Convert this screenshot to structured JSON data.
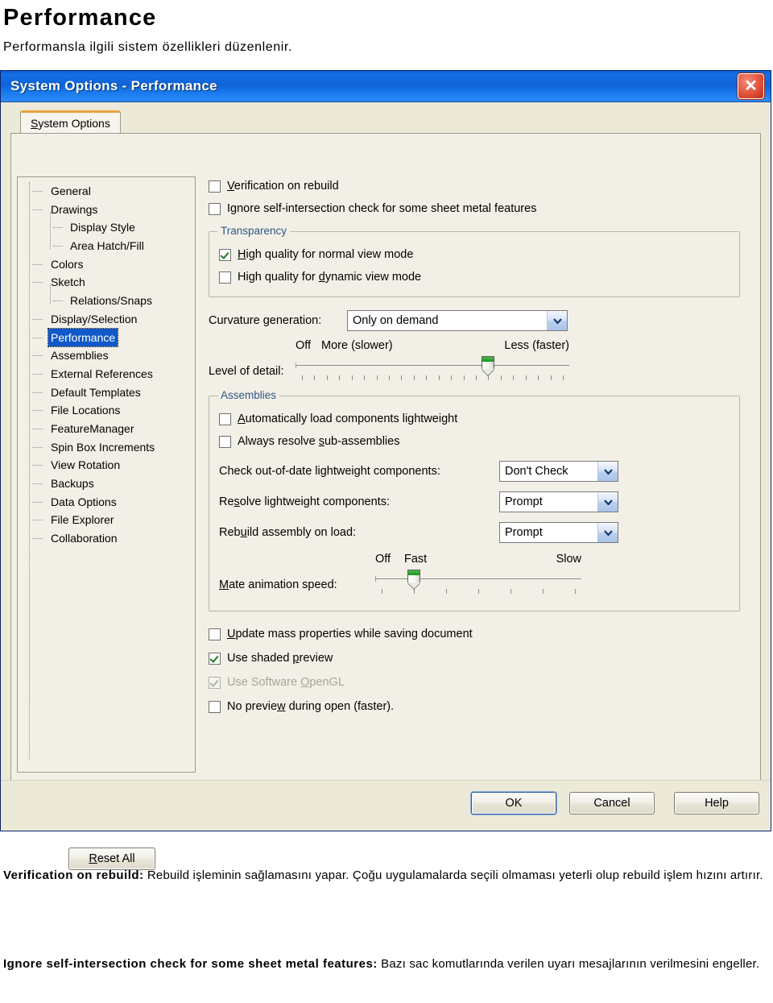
{
  "page": {
    "title": "Performance",
    "subtitle": "Performansla ilgili sistem özellikleri düzenlenir."
  },
  "dialog": {
    "title": "System Options - Performance",
    "close_icon": "✕",
    "tab": {
      "label_pre": "S",
      "label_rest": "ystem Options",
      "full": "System Options"
    }
  },
  "tree": {
    "items": [
      {
        "label": "General",
        "level": 1,
        "selected": false
      },
      {
        "label": "Drawings",
        "level": 1,
        "selected": false
      },
      {
        "label": "Display Style",
        "level": 2,
        "selected": false
      },
      {
        "label": "Area Hatch/Fill",
        "level": 2,
        "selected": false
      },
      {
        "label": "Colors",
        "level": 1,
        "selected": false
      },
      {
        "label": "Sketch",
        "level": 1,
        "selected": false
      },
      {
        "label": "Relations/Snaps",
        "level": 2,
        "selected": false
      },
      {
        "label": "Display/Selection",
        "level": 1,
        "selected": false
      },
      {
        "label": "Performance",
        "level": 1,
        "selected": true
      },
      {
        "label": "Assemblies",
        "level": 1,
        "selected": false
      },
      {
        "label": "External References",
        "level": 1,
        "selected": false
      },
      {
        "label": "Default Templates",
        "level": 1,
        "selected": false
      },
      {
        "label": "File Locations",
        "level": 1,
        "selected": false
      },
      {
        "label": "FeatureManager",
        "level": 1,
        "selected": false
      },
      {
        "label": "Spin Box Increments",
        "level": 1,
        "selected": false
      },
      {
        "label": "View Rotation",
        "level": 1,
        "selected": false
      },
      {
        "label": "Backups",
        "level": 1,
        "selected": false
      },
      {
        "label": "Data Options",
        "level": 1,
        "selected": false
      },
      {
        "label": "File Explorer",
        "level": 1,
        "selected": false
      },
      {
        "label": "Collaboration",
        "level": 1,
        "selected": false
      }
    ]
  },
  "options": {
    "verification_on_rebuild": {
      "label": "Verification on rebuild",
      "mnemonic": "V",
      "rest": "erification on rebuild",
      "checked": false
    },
    "ignore_self_intersection": {
      "label": "Ignore self-intersection check for some sheet metal features",
      "pre": "I",
      "mnemonic": "g",
      "rest": "nore self-intersection check for some sheet metal features",
      "checked": false
    },
    "transparency": {
      "title": "Transparency",
      "high_quality_normal": {
        "label": "High quality for normal view mode",
        "mnemonic": "H",
        "rest": "igh quality for normal view mode",
        "checked": true
      },
      "high_quality_dynamic": {
        "label": "High quality for dynamic view mode",
        "pre": "High quality for ",
        "mnemonic": "d",
        "rest": "ynamic view mode",
        "checked": false
      }
    },
    "curvature_generation": {
      "label": "Curvature generation:",
      "value": "Only on demand"
    },
    "level_of_detail": {
      "label": "Level of detail:",
      "cap_off": "Off",
      "cap_more": "More (slower)",
      "cap_less": "Less (faster)",
      "ticks": 22,
      "value_index": 15
    },
    "assemblies": {
      "title": "Assemblies",
      "auto_load_lightweight": {
        "label": "Automatically load components lightweight",
        "mnemonic": "A",
        "rest": "utomatically load components lightweight",
        "checked": false
      },
      "always_resolve_sub": {
        "label": "Always resolve sub-assemblies",
        "pre": "Always resolve ",
        "mnemonic": "s",
        "rest": "ub-assemblies",
        "checked": false
      },
      "check_out_of_date": {
        "label": "Check out-of-date lightweight components:",
        "value": "Don't Check"
      },
      "resolve_lightweight": {
        "label": "Resolve lightweight components:",
        "pre": "Re",
        "mnemonic": "s",
        "rest": "olve lightweight components:",
        "value": "Prompt"
      },
      "rebuild_on_load": {
        "label": "Rebuild assembly on load:",
        "pre": "Reb",
        "mnemonic": "u",
        "rest": "ild assembly on load:",
        "value": "Prompt"
      },
      "mate_animation": {
        "label": "Mate animation speed:",
        "mnemonic": "M",
        "rest": "ate animation speed:",
        "cap_off": "Off",
        "cap_fast": "Fast",
        "cap_slow": "Slow",
        "ticks": 7,
        "value_index": 1
      }
    },
    "update_mass_properties": {
      "label": "Update mass properties while saving document",
      "mnemonic": "U",
      "rest": "pdate mass properties while saving document",
      "checked": false
    },
    "use_shaded_preview": {
      "label": "Use shaded preview",
      "pre": "Use shaded ",
      "mnemonic": "p",
      "rest": "review",
      "checked": true
    },
    "use_software_opengl": {
      "label": "Use Software OpenGL",
      "pre": "Use Software ",
      "mnemonic": "O",
      "rest": "penGL",
      "checked": true,
      "disabled": true
    },
    "no_preview_during_open": {
      "label": "No preview during open (faster).",
      "pre": "No previe",
      "mnemonic": "w",
      "rest": " during open (faster).",
      "checked": false
    }
  },
  "buttons": {
    "reset_all": {
      "pre": "R",
      "mnemonic": "R",
      "rest": "eset All",
      "label": "Reset All"
    },
    "ok": "OK",
    "cancel": "Cancel",
    "help": "Help"
  },
  "descriptions": [
    {
      "term": "Verification on rebuild:",
      "body": " Rebuild işleminin sağlamasını yapar. Çoğu uygulamalarda seçili olmaması yeterli olup rebuild işlem hızını artırır."
    },
    {
      "term": "Ignore self-intersection check for some sheet metal features:",
      "body": " Bazı sac komutlarında verilen uyarı mesajlarının verilmesini engeller."
    }
  ],
  "colors": {
    "titlebar_blue": "#0f62d6",
    "selection_blue": "#1158c8",
    "dialog_face": "#ece9d8",
    "panel_face": "#f2f0e6",
    "group_title": "#2f5585",
    "slider_green": "#17921f",
    "tab_accent": "#e8a33d",
    "close_red": "#e1533a"
  }
}
